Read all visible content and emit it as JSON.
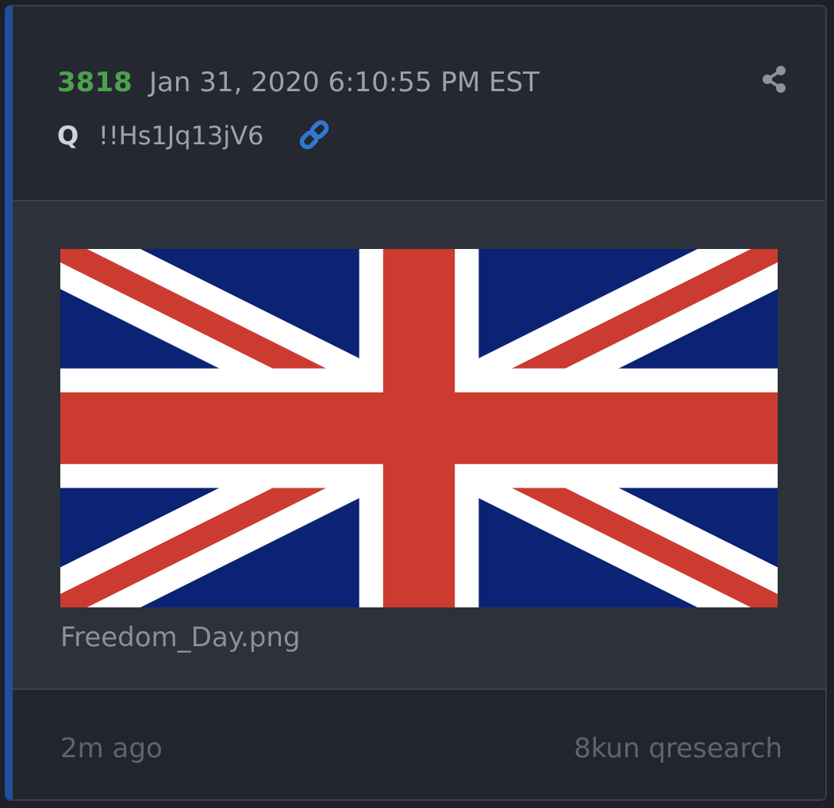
{
  "post": {
    "number": "3818",
    "timestamp": "Jan 31, 2020 6:10:55 PM EST",
    "author": "Q",
    "tripcode": "!!Hs1Jq13jV6"
  },
  "icons": {
    "share": "share-icon",
    "link": "link-icon"
  },
  "attachment": {
    "filename": "Freedom_Day.png",
    "image": "union-jack-flag"
  },
  "footer": {
    "age": "2m ago",
    "source": "8kun qresearch"
  },
  "colors": {
    "accent_border": "#1f4f9a",
    "post_number": "#4ca24d",
    "link_icon": "#2f7ad0"
  }
}
